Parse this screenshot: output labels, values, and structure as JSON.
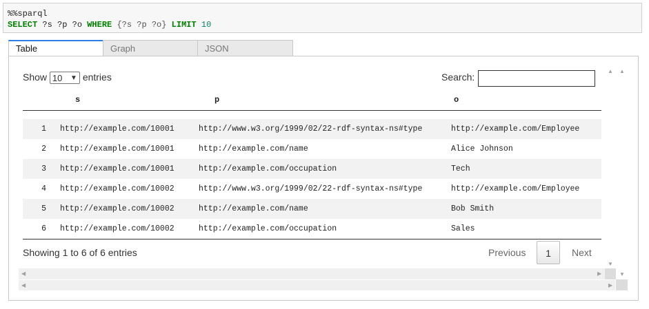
{
  "code": {
    "magic": "%%sparql",
    "tokens": {
      "select": "SELECT",
      "vars": " ?s ?p ?o ",
      "where": "WHERE",
      "pattern": " {?s ?p ?o} ",
      "limit": "LIMIT",
      "limit_value": " 10"
    }
  },
  "tabs": [
    "Table",
    "Graph",
    "JSON"
  ],
  "controls": {
    "show_label": "Show",
    "page_size": "10",
    "entries_label": "entries",
    "search_label": "Search:",
    "search_value": ""
  },
  "table": {
    "columns": [
      "s",
      "p",
      "o"
    ],
    "rows": [
      {
        "idx": "1",
        "s": "http://example.com/10001",
        "p": "http://www.w3.org/1999/02/22-rdf-syntax-ns#type",
        "o": "http://example.com/Employee"
      },
      {
        "idx": "2",
        "s": "http://example.com/10001",
        "p": "http://example.com/name",
        "o": "Alice Johnson"
      },
      {
        "idx": "3",
        "s": "http://example.com/10001",
        "p": "http://example.com/occupation",
        "o": "Tech"
      },
      {
        "idx": "4",
        "s": "http://example.com/10002",
        "p": "http://www.w3.org/1999/02/22-rdf-syntax-ns#type",
        "o": "http://example.com/Employee"
      },
      {
        "idx": "5",
        "s": "http://example.com/10002",
        "p": "http://example.com/name",
        "o": "Bob Smith"
      },
      {
        "idx": "6",
        "s": "http://example.com/10002",
        "p": "http://example.com/occupation",
        "o": "Sales"
      }
    ]
  },
  "footer": {
    "info": "Showing 1 to 6 of 6 entries",
    "previous": "Previous",
    "page": "1",
    "next": "Next"
  },
  "colors": {
    "keyword": "#008000",
    "active_tab_accent": "#2b7de9"
  }
}
